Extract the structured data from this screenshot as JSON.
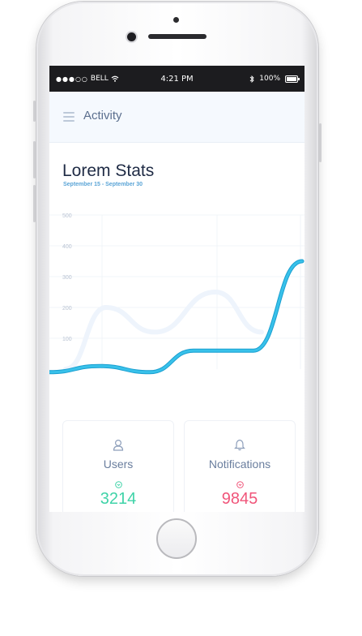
{
  "status_bar": {
    "carrier": "BELL",
    "time": "4:21 PM",
    "battery": "100%"
  },
  "app_bar": {
    "title": "Activity"
  },
  "stats": {
    "title": "Lorem Stats",
    "date_range": "September 15 - September 30"
  },
  "chart_data": {
    "type": "line",
    "y_ticks": [
      500,
      400,
      300,
      200,
      100
    ],
    "ylim": [
      0,
      500
    ],
    "grid": true,
    "series": [
      {
        "values": [
          0,
          200,
          120,
          250,
          120
        ],
        "color": "#eef4fc"
      },
      {
        "values": [
          -10,
          10,
          -10,
          60,
          60,
          350
        ],
        "color": "#38c1ea"
      }
    ]
  },
  "cards": [
    {
      "label": "Users",
      "value": "3214",
      "icon": "user-icon",
      "value_color": "#3fd3a8",
      "mini_color": "#3fd3a8"
    },
    {
      "label": "Notifications",
      "value": "9845",
      "icon": "bell-icon",
      "value_color": "#f0557a",
      "mini_color": "#f0557a"
    }
  ],
  "colors": {
    "accent": "#38c1ea",
    "title": "#1f2b45",
    "appbar_bg": "#f5f9fe"
  }
}
